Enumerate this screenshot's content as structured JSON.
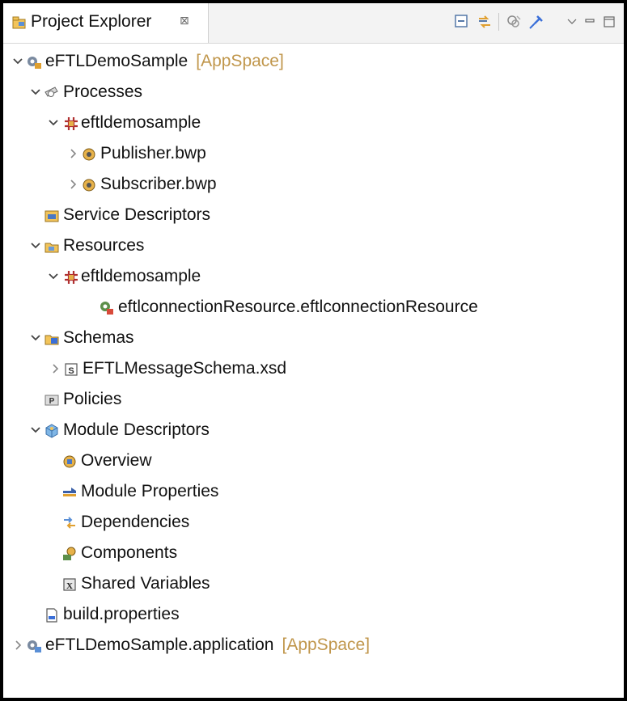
{
  "view": {
    "tab_title": "Project Explorer",
    "tab_close_glyph": "⊠",
    "toolbar": [
      "collapse-all-icon",
      "link-with-editor-icon",
      "filter-icon",
      "pin-icon",
      "view-menu-icon",
      "minimize-icon",
      "maximize-icon"
    ]
  },
  "tree": {
    "project": {
      "label": "eFTLDemoSample",
      "decoration": "[AppSpace]"
    },
    "processes": {
      "label": "Processes"
    },
    "processes_pkg": {
      "label": "eftldemosample"
    },
    "publisher": {
      "label": "Publisher.bwp"
    },
    "subscriber": {
      "label": "Subscriber.bwp"
    },
    "service_descriptors": {
      "label": "Service Descriptors"
    },
    "resources": {
      "label": "Resources"
    },
    "resources_pkg": {
      "label": "eftldemosample"
    },
    "eftl_resource": {
      "label": "eftlconnectionResource.eftlconnectionResource"
    },
    "schemas": {
      "label": "Schemas"
    },
    "eftl_schema": {
      "label": "EFTLMessageSchema.xsd"
    },
    "policies": {
      "label": "Policies"
    },
    "module_descriptors": {
      "label": "Module Descriptors"
    },
    "overview": {
      "label": "Overview"
    },
    "module_properties": {
      "label": "Module Properties"
    },
    "dependencies": {
      "label": "Dependencies"
    },
    "components": {
      "label": "Components"
    },
    "shared_variables": {
      "label": "Shared Variables"
    },
    "build_properties": {
      "label": "build.properties"
    },
    "application": {
      "label": "eFTLDemoSample.application",
      "decoration": "[AppSpace]"
    }
  },
  "colors": {
    "decoration": "#c0964b",
    "header_bg": "#f3f3f3",
    "border": "#000000"
  }
}
